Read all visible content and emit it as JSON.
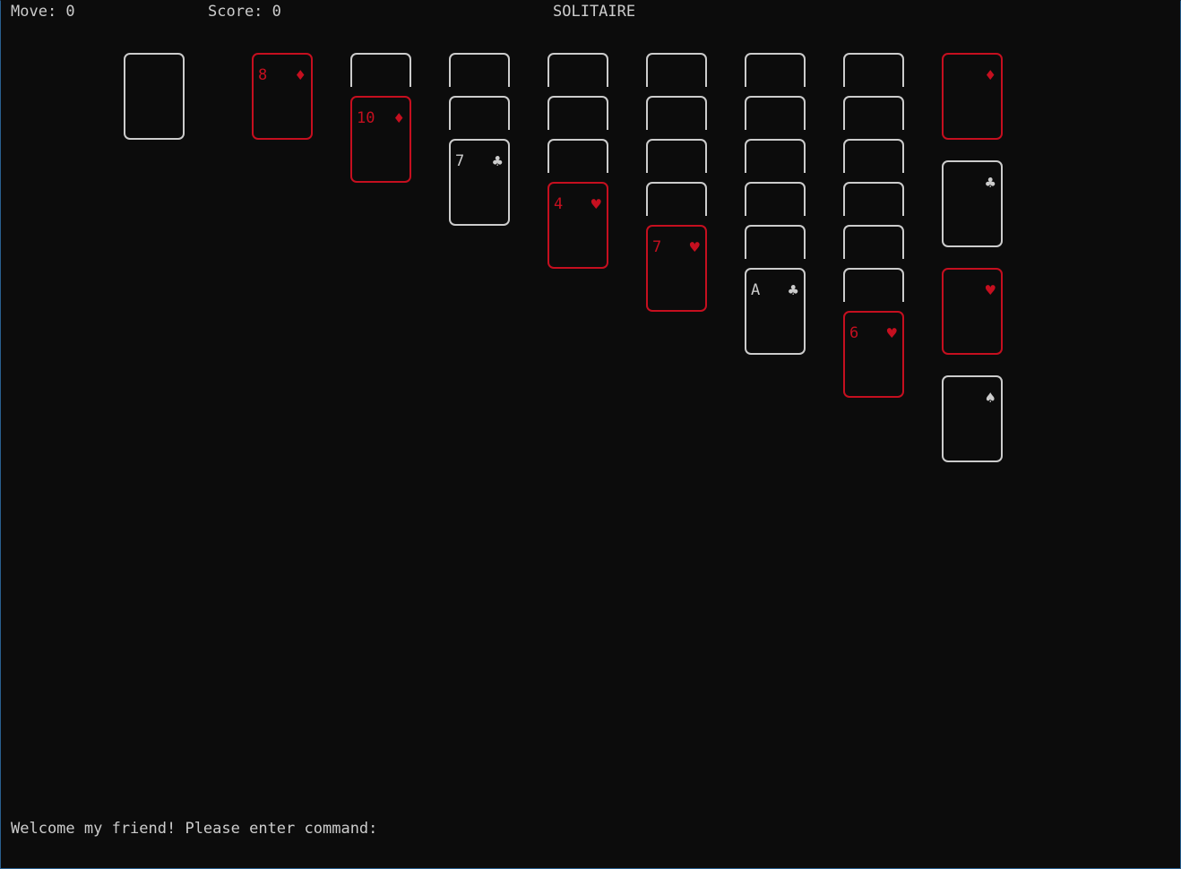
{
  "hud": {
    "move": "Move: 0",
    "score": "Score: 0",
    "title": "SOLITAIRE"
  },
  "stock": {
    "state": "empty"
  },
  "waste": {
    "rank": "8",
    "suit": "♦",
    "color": "red"
  },
  "tableau": [
    {
      "hidden": 1,
      "top": {
        "rank": "10",
        "suit": "♦",
        "color": "red"
      }
    },
    {
      "hidden": 2,
      "top": {
        "rank": "7",
        "suit": "♣",
        "color": "black"
      }
    },
    {
      "hidden": 3,
      "top": {
        "rank": "4",
        "suit": "♥",
        "color": "red"
      }
    },
    {
      "hidden": 4,
      "top": {
        "rank": "7",
        "suit": "♥",
        "color": "red"
      }
    },
    {
      "hidden": 5,
      "top": {
        "rank": "A",
        "suit": "♣",
        "color": "black"
      }
    },
    {
      "hidden": 6,
      "top": {
        "rank": "6",
        "suit": "♥",
        "color": "red"
      }
    }
  ],
  "foundations": [
    {
      "rank": "",
      "suit": "♦",
      "color": "red"
    },
    {
      "rank": "",
      "suit": "♣",
      "color": "black"
    },
    {
      "rank": "",
      "suit": "♥",
      "color": "red"
    },
    {
      "rank": "",
      "suit": "♠",
      "color": "black"
    }
  ],
  "prompt": "Welcome my friend! Please enter command:",
  "colors": {
    "background": "#0c0c0c",
    "text": "#cccccc",
    "red": "#c50f1f"
  }
}
